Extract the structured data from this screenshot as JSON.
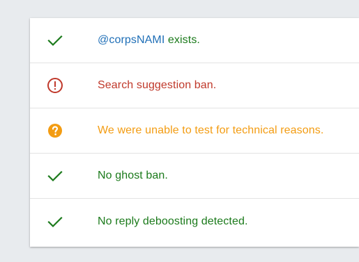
{
  "colors": {
    "ok": "#1b7a1b",
    "error": "#c0392b",
    "warning": "#f39c12",
    "link": "#1f6fb7"
  },
  "results": [
    {
      "icon": "check-icon",
      "status": "ok",
      "handle": "@corpsNAMI",
      "text": " exists."
    },
    {
      "icon": "alert-circle-icon",
      "status": "error",
      "text": "Search suggestion ban."
    },
    {
      "icon": "help-circle-icon",
      "status": "warning",
      "text": "We were unable to test for technical reasons."
    },
    {
      "icon": "check-icon",
      "status": "ok",
      "text": "No ghost ban."
    },
    {
      "icon": "check-icon",
      "status": "ok",
      "text": "No reply deboosting detected."
    }
  ]
}
